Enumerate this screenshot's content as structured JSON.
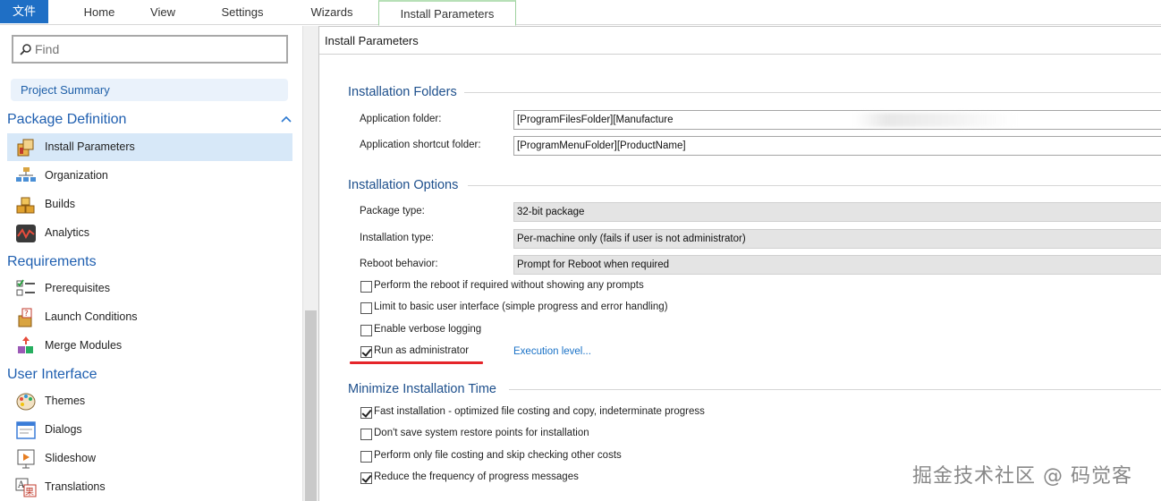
{
  "ribbon": {
    "tabs": [
      "文件",
      "Home",
      "View",
      "Settings",
      "Wizards",
      "Install Parameters"
    ],
    "active_tab": "Install Parameters",
    "file_color": "#1f6fc5"
  },
  "sidebar": {
    "find_placeholder": "Find",
    "project_summary": "Project Summary",
    "groups": {
      "package_definition": "Package Definition",
      "requirements": "Requirements",
      "user_interface": "User Interface"
    },
    "items": {
      "install_parameters": "Install Parameters",
      "organization": "Organization",
      "builds": "Builds",
      "analytics": "Analytics",
      "prerequisites": "Prerequisites",
      "launch_conditions": "Launch Conditions",
      "merge_modules": "Merge Modules",
      "themes": "Themes",
      "dialogs": "Dialogs",
      "slideshow": "Slideshow",
      "translations": "Translations"
    },
    "selected": "Install Parameters"
  },
  "main": {
    "title": "Install Parameters",
    "folders": {
      "heading": "Installation Folders",
      "app_folder_label": "Application folder:",
      "app_folder_value": "[ProgramFilesFolder][Manufacture",
      "shortcut_label": "Application shortcut folder:",
      "shortcut_value": "[ProgramMenuFolder][ProductName]"
    },
    "options": {
      "heading": "Installation Options",
      "package_type_label": "Package type:",
      "package_type_value": "32-bit package",
      "install_type_label": "Installation type:",
      "install_type_value": "Per-machine only (fails if user is not administrator)",
      "reboot_label": "Reboot behavior:",
      "reboot_value": "Prompt for Reboot when required",
      "checkboxes": [
        {
          "label": "Perform the reboot if required without showing any prompts",
          "checked": false
        },
        {
          "label": "Limit to basic user interface (simple progress and error handling)",
          "checked": false
        },
        {
          "label": "Enable verbose logging",
          "checked": false
        },
        {
          "label": "Run as administrator",
          "checked": true
        }
      ],
      "execution_link": "Execution level..."
    },
    "minimize": {
      "heading": "Minimize Installation Time",
      "checkboxes": [
        {
          "label": "Fast installation - optimized file costing and copy, indeterminate progress",
          "checked": true
        },
        {
          "label": "Don't save system restore points for installation",
          "checked": false
        },
        {
          "label": "Perform only file costing and skip checking other costs",
          "checked": false
        },
        {
          "label": "Reduce the frequency of progress messages",
          "checked": true
        }
      ]
    }
  },
  "watermark": "掘金技术社区 @ 码觉客",
  "colors": {
    "accent": "#1f5fb0",
    "selection": "#d7e8f8",
    "underline": "#e5252a"
  }
}
